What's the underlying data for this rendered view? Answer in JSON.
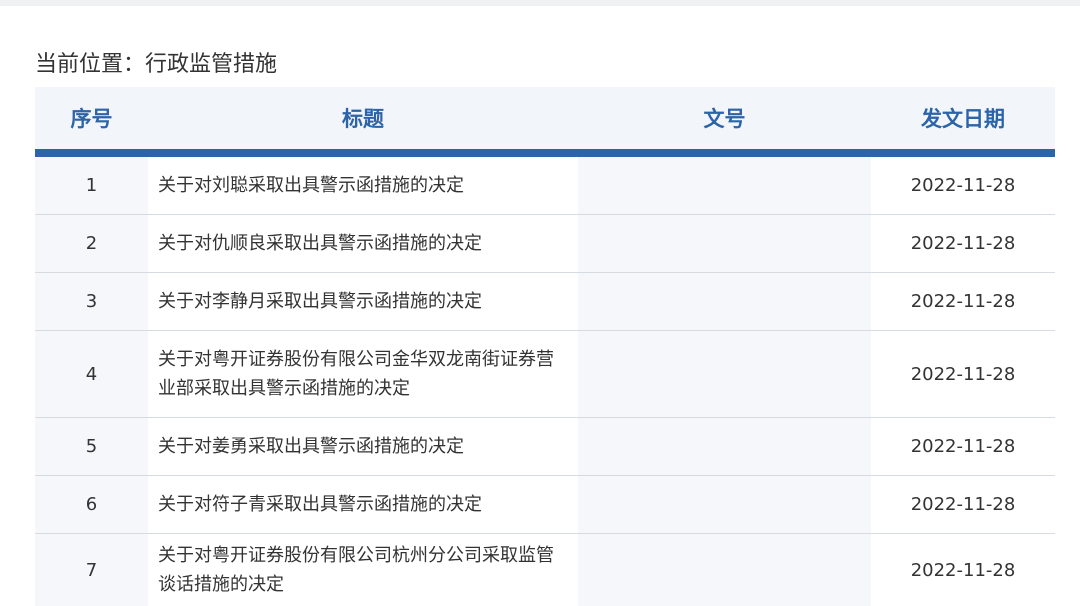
{
  "breadcrumb": {
    "label": "当前位置：",
    "current": "行政监管措施"
  },
  "table": {
    "headers": {
      "index": "序号",
      "title": "标题",
      "doc_no": "文号",
      "date": "发文日期"
    },
    "rows": [
      {
        "index": "1",
        "title": "关于对刘聪采取出具警示函措施的决定",
        "doc_no": "",
        "date": "2022-11-28"
      },
      {
        "index": "2",
        "title": "关于对仇顺良采取出具警示函措施的决定",
        "doc_no": "",
        "date": "2022-11-28"
      },
      {
        "index": "3",
        "title": "关于对李静月采取出具警示函措施的决定",
        "doc_no": "",
        "date": "2022-11-28"
      },
      {
        "index": "4",
        "title": "关于对粤开证券股份有限公司金华双龙南街证券营业部采取出具警示函措施的决定",
        "doc_no": "",
        "date": "2022-11-28"
      },
      {
        "index": "5",
        "title": "关于对姜勇采取出具警示函措施的决定",
        "doc_no": "",
        "date": "2022-11-28"
      },
      {
        "index": "6",
        "title": "关于对符子青采取出具警示函措施的决定",
        "doc_no": "",
        "date": "2022-11-28"
      },
      {
        "index": "7",
        "title": "关于对粤开证券股份有限公司杭州分公司采取监管谈话措施的决定",
        "doc_no": "",
        "date": "2022-11-28"
      }
    ]
  },
  "colors": {
    "header_text": "#2b64a8",
    "header_rule": "#2e63ac",
    "header_bg": "#f2f5fa",
    "shaded_column_bg": "#f5f7fa"
  }
}
